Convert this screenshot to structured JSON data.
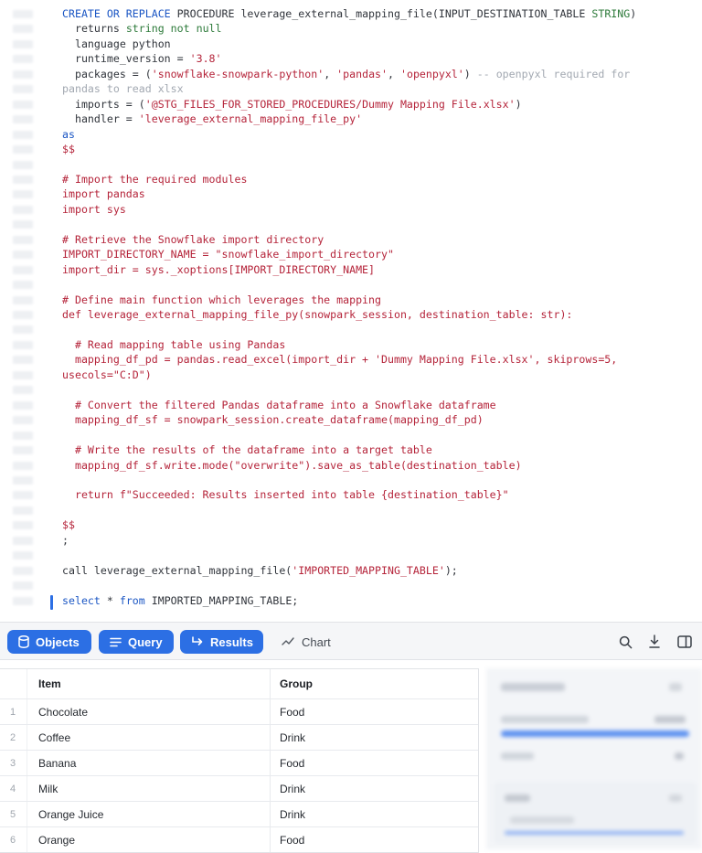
{
  "editor": {
    "lines": [
      [
        {
          "t": "CREATE OR REPLACE",
          "c": "kw"
        },
        {
          "t": " PROCEDURE leverage_external_mapping_file(INPUT_DESTINATION_TABLE ",
          "c": "df"
        },
        {
          "t": "STRING",
          "c": "gr"
        },
        {
          "t": ")",
          "c": "df"
        }
      ],
      [
        {
          "t": "  returns ",
          "c": "df"
        },
        {
          "t": "string not null",
          "c": "gr"
        }
      ],
      [
        {
          "t": "  language python",
          "c": "df"
        }
      ],
      [
        {
          "t": "  runtime_version = ",
          "c": "df"
        },
        {
          "t": "'3.8'",
          "c": "st"
        }
      ],
      [
        {
          "t": "  packages = (",
          "c": "df"
        },
        {
          "t": "'snowflake-snowpark-python'",
          "c": "st"
        },
        {
          "t": ", ",
          "c": "df"
        },
        {
          "t": "'pandas'",
          "c": "st"
        },
        {
          "t": ", ",
          "c": "df"
        },
        {
          "t": "'openpyxl'",
          "c": "st"
        },
        {
          "t": ") ",
          "c": "df"
        },
        {
          "t": "-- openpyxl required for",
          "c": "cm"
        }
      ],
      [
        {
          "t": "pandas to read xlsx",
          "c": "cm",
          "x": 0
        }
      ],
      [
        {
          "t": "  imports = (",
          "c": "df"
        },
        {
          "t": "'@STG_FILES_FOR_STORED_PROCEDURES/Dummy Mapping File.xlsx'",
          "c": "st"
        },
        {
          "t": ")",
          "c": "df"
        }
      ],
      [
        {
          "t": "  handler = ",
          "c": "df"
        },
        {
          "t": "'leverage_external_mapping_file_py'",
          "c": "st"
        }
      ],
      [
        {
          "t": "as",
          "c": "kw"
        }
      ],
      [
        {
          "t": "$$",
          "c": "st"
        }
      ],
      [
        {
          "t": "",
          "c": "st"
        }
      ],
      [
        {
          "t": "# Import the required modules",
          "c": "st"
        }
      ],
      [
        {
          "t": "import pandas",
          "c": "st"
        }
      ],
      [
        {
          "t": "import sys",
          "c": "st"
        }
      ],
      [
        {
          "t": "",
          "c": "st"
        }
      ],
      [
        {
          "t": "# Retrieve the Snowflake import directory",
          "c": "st"
        }
      ],
      [
        {
          "t": "IMPORT_DIRECTORY_NAME = \"snowflake_import_directory\"",
          "c": "st"
        }
      ],
      [
        {
          "t": "import_dir = sys._xoptions[IMPORT_DIRECTORY_NAME]",
          "c": "st"
        }
      ],
      [
        {
          "t": "",
          "c": "st"
        }
      ],
      [
        {
          "t": "# Define main function which leverages the mapping",
          "c": "st"
        }
      ],
      [
        {
          "t": "def leverage_external_mapping_file_py(snowpark_session, destination_table: str):",
          "c": "st"
        }
      ],
      [
        {
          "t": "",
          "c": "st"
        }
      ],
      [
        {
          "t": "  # Read mapping table using Pandas",
          "c": "st"
        }
      ],
      [
        {
          "t": "  mapping_df_pd = pandas.read_excel(import_dir + 'Dummy Mapping File.xlsx', skiprows=5,",
          "c": "st"
        }
      ],
      [
        {
          "t": "usecols=\"C:D\")",
          "c": "st"
        }
      ],
      [
        {
          "t": "",
          "c": "st"
        }
      ],
      [
        {
          "t": "  # Convert the filtered Pandas dataframe into a Snowflake dataframe",
          "c": "st"
        }
      ],
      [
        {
          "t": "  mapping_df_sf = snowpark_session.create_dataframe(mapping_df_pd)",
          "c": "st"
        }
      ],
      [
        {
          "t": "",
          "c": "st"
        }
      ],
      [
        {
          "t": "  # Write the results of the dataframe into a target table",
          "c": "st"
        }
      ],
      [
        {
          "t": "  mapping_df_sf.write.mode(\"overwrite\").save_as_table(destination_table)",
          "c": "st"
        }
      ],
      [
        {
          "t": "",
          "c": "st"
        }
      ],
      [
        {
          "t": "  return f\"Succeeded: Results inserted into table {destination_table}\"",
          "c": "st"
        }
      ],
      [
        {
          "t": "",
          "c": "st"
        }
      ],
      [
        {
          "t": "$$",
          "c": "st"
        }
      ],
      [
        {
          "t": ";",
          "c": "df"
        }
      ],
      [
        {
          "t": "",
          "c": "st"
        }
      ],
      [
        {
          "t": "call leverage_external_mapping_file(",
          "c": "df"
        },
        {
          "t": "'IMPORTED_MAPPING_TABLE'",
          "c": "st"
        },
        {
          "t": ");",
          "c": "df"
        }
      ],
      [
        {
          "t": "",
          "c": "st"
        }
      ],
      [
        {
          "t": "select",
          "c": "kw"
        },
        {
          "t": " * ",
          "c": "df"
        },
        {
          "t": "from",
          "c": "kw"
        },
        {
          "t": " IMPORTED_MAPPING_TABLE;",
          "c": "df"
        }
      ]
    ]
  },
  "toolbar": {
    "objects_label": "Objects",
    "query_label": "Query",
    "results_label": "Results",
    "chart_label": "Chart",
    "icons": [
      "database-icon",
      "list-icon",
      "return-arrow-icon",
      "chart-line-icon",
      "search-icon",
      "download-icon",
      "split-panel-icon"
    ]
  },
  "results": {
    "columns": [
      "Item",
      "Group"
    ],
    "rows": [
      {
        "index": "1",
        "item": "Chocolate",
        "group": "Food"
      },
      {
        "index": "2",
        "item": "Coffee",
        "group": "Drink"
      },
      {
        "index": "3",
        "item": "Banana",
        "group": "Food"
      },
      {
        "index": "4",
        "item": "Milk",
        "group": "Drink"
      },
      {
        "index": "5",
        "item": "Orange Juice",
        "group": "Drink"
      },
      {
        "index": "6",
        "item": "Orange",
        "group": "Food"
      }
    ]
  },
  "colors": {
    "accent": "#2c6fe4",
    "keyword": "#1b56c4",
    "string": "#b5243a",
    "type": "#2d7a3a",
    "comment": "#a2a8b1"
  }
}
